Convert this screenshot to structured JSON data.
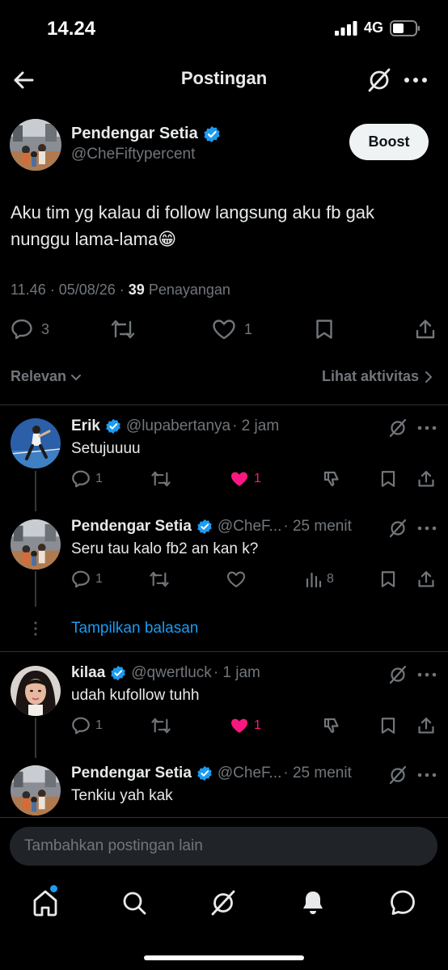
{
  "status_bar": {
    "time": "14.24",
    "network": "4G"
  },
  "header": {
    "title": "Postingan"
  },
  "post": {
    "author_name": "Pendengar Setia",
    "author_handle": "@CheFiftypercent",
    "boost_label": "Boost",
    "text": "Aku tim yg kalau di follow langsung aku fb gak nunggu lama-lama😁",
    "time": "11.46",
    "date": "05/08/26",
    "views": "39",
    "views_label": "Penayangan",
    "reply_count": "3",
    "like_count": "1"
  },
  "sort": {
    "label": "Relevan",
    "activity_label": "Lihat aktivitas"
  },
  "replies": [
    {
      "name": "Erik",
      "handle": "@lupabertanya",
      "time": "· 2 jam",
      "text": "Setujuuuu",
      "reply_count": "1",
      "like_count": "1",
      "liked": true
    },
    {
      "name": "Pendengar Setia",
      "handle": "@CheF...",
      "time": "· 25 menit",
      "text": "Seru tau kalo fb2 an kan k?",
      "reply_count": "1",
      "views": "8",
      "liked": false
    },
    {
      "name": "kilaa",
      "handle": "@qwertluck",
      "time": "· 1 jam",
      "text": "udah kufollow tuhh",
      "reply_count": "1",
      "like_count": "1",
      "liked": true
    },
    {
      "name": "Pendengar Setia",
      "handle": "@CheF...",
      "time": "· 25 menit",
      "text": "Tenkiu yah kak"
    }
  ],
  "show_replies": "Tampilkan balasan",
  "composer": {
    "placeholder": "Tambahkan postingan lain"
  },
  "colors": {
    "accent": "#1d9bf0",
    "like": "#f91880",
    "verified": "#1d9bf0"
  }
}
